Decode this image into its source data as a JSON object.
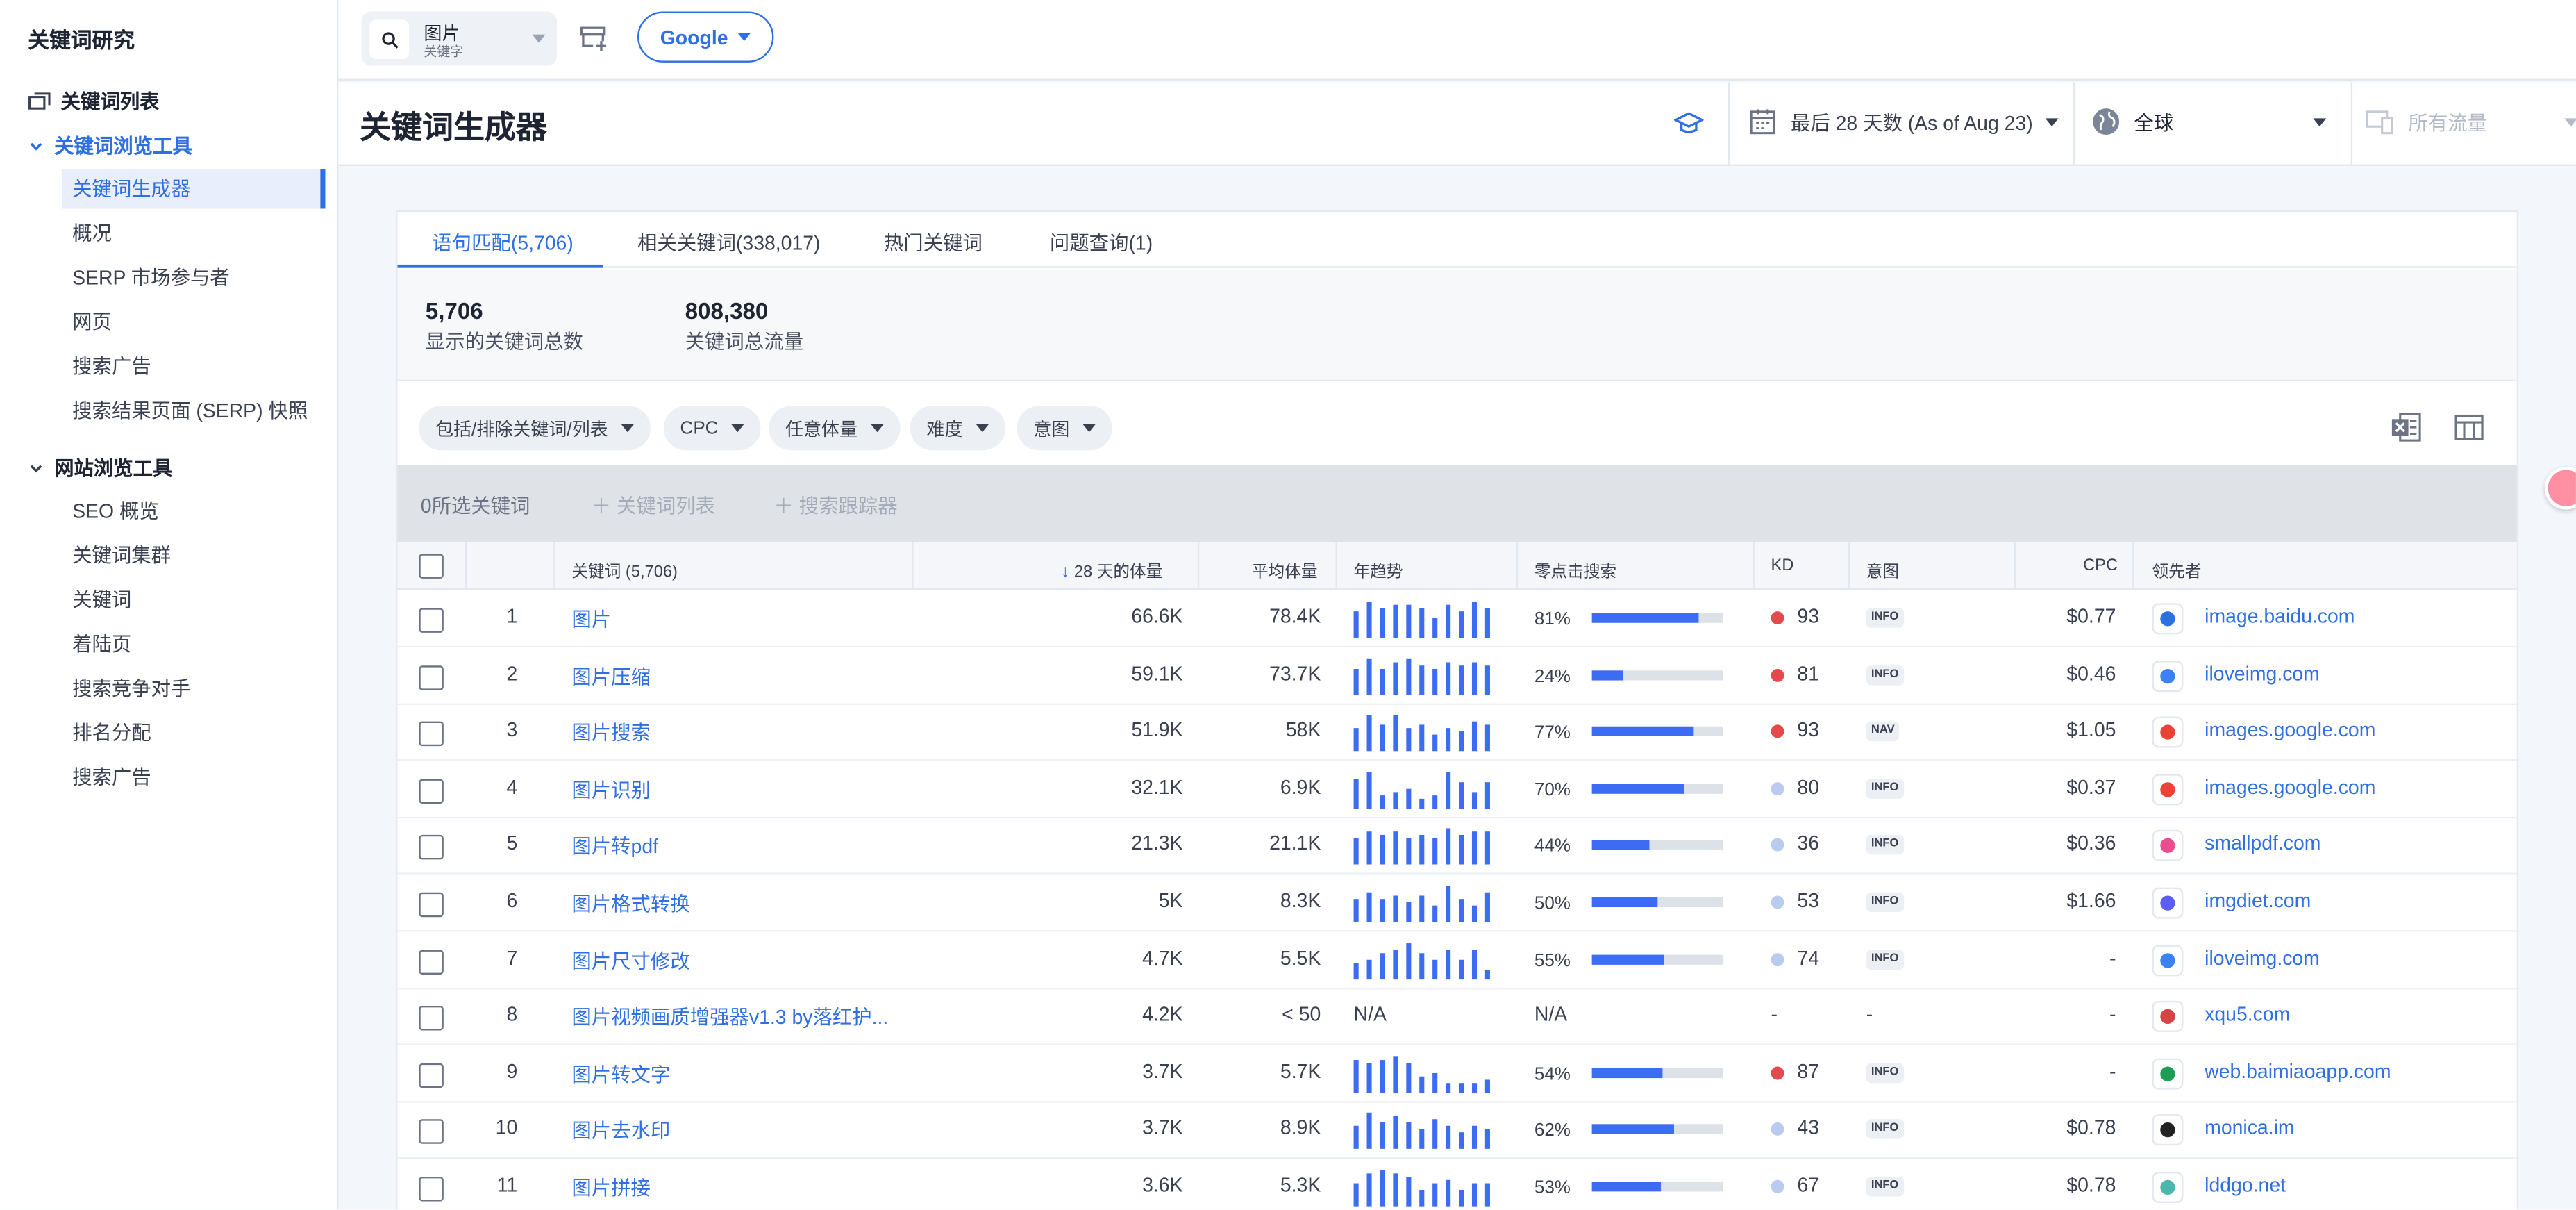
{
  "sidebar": {
    "title": "关键词研究",
    "list_label": "关键词列表",
    "section1_label": "关键词浏览工具",
    "section1_items": [
      {
        "label": "关键词生成器"
      },
      {
        "label": "概况"
      },
      {
        "label": "SERP 市场参与者"
      },
      {
        "label": "网页"
      },
      {
        "label": "搜索广告"
      },
      {
        "label": "搜索结果页面 (SERP) 快照"
      }
    ],
    "section2_label": "网站浏览工具",
    "section2_items": [
      {
        "label": "SEO 概览"
      },
      {
        "label": "关键词集群"
      },
      {
        "label": "关键词"
      },
      {
        "label": "着陆页"
      },
      {
        "label": "搜索竞争对手"
      },
      {
        "label": "排名分配"
      },
      {
        "label": "搜索广告"
      }
    ]
  },
  "topbar": {
    "search_value": "图片",
    "search_type": "关键字",
    "engine_label": "Google"
  },
  "header": {
    "title": "关键词生成器",
    "date_range": "最后 28 天数 (As of Aug 23)",
    "region": "全球",
    "traffic": "所有流量"
  },
  "tabs": [
    {
      "label": "语句匹配(5,706)"
    },
    {
      "label": "相关关键词(338,017)"
    },
    {
      "label": "热门关键词"
    },
    {
      "label": "问题查询(1)"
    }
  ],
  "stats": {
    "total_keywords": "5,706",
    "total_keywords_label": "显示的关键词总数",
    "total_traffic": "808,380",
    "total_traffic_label": "关键词总流量"
  },
  "filters": [
    {
      "label": "包括/排除关键词/列表"
    },
    {
      "label": "CPC"
    },
    {
      "label": "任意体量"
    },
    {
      "label": "难度"
    },
    {
      "label": "意图"
    }
  ],
  "selection": {
    "count_label": "0所选关键词",
    "add_list": "关键词列表",
    "add_tracker": "搜索跟踪器"
  },
  "table": {
    "headers": {
      "keyword": "关键词 (5,706)",
      "volume28": "28 天的体量",
      "avg": "平均体量",
      "trend": "年趋势",
      "zero_click": "零点击搜索",
      "kd": "KD",
      "intent": "意图",
      "cpc": "CPC",
      "leader": "领先者"
    },
    "rows": [
      {
        "rank": "1",
        "keyword": "图片",
        "volume": "66.6K",
        "avg": "78.4K",
        "trend": [
          16,
          22,
          18,
          20,
          20,
          18,
          12,
          20,
          16,
          22,
          18
        ],
        "zero": "81%",
        "zero_frac": 0.81,
        "kd": "93",
        "kd_color": "#e5484d",
        "intent": "INFO",
        "cpc": "$0.77",
        "leader": "image.baidu.com",
        "fav": "paw-icon",
        "fav_color": "#2f6fe4"
      },
      {
        "rank": "2",
        "keyword": "图片压缩",
        "volume": "59.1K",
        "avg": "73.7K",
        "trend": [
          16,
          22,
          16,
          20,
          22,
          18,
          16,
          20,
          18,
          20,
          18
        ],
        "zero": "24%",
        "zero_frac": 0.24,
        "kd": "81",
        "kd_color": "#e5484d",
        "intent": "INFO",
        "cpc": "$0.46",
        "leader": "iloveimg.com",
        "fav": "heart-icon",
        "fav_color": "#3b82f6"
      },
      {
        "rank": "3",
        "keyword": "图片搜索",
        "volume": "51.9K",
        "avg": "58K",
        "trend": [
          14,
          22,
          16,
          22,
          14,
          16,
          10,
          14,
          12,
          18,
          16
        ],
        "zero": "77%",
        "zero_frac": 0.77,
        "kd": "93",
        "kd_color": "#e5484d",
        "intent": "NAV",
        "cpc": "$1.05",
        "leader": "images.google.com",
        "fav": "google-icon",
        "fav_color": "#ea4335"
      },
      {
        "rank": "4",
        "keyword": "图片识别",
        "volume": "32.1K",
        "avg": "6.9K",
        "trend": [
          18,
          22,
          8,
          10,
          12,
          6,
          8,
          22,
          16,
          10,
          16
        ],
        "zero": "70%",
        "zero_frac": 0.7,
        "kd": "80",
        "kd_color": "#b9ccef",
        "intent": "INFO",
        "cpc": "$0.37",
        "leader": "images.google.com",
        "fav": "google-icon",
        "fav_color": "#ea4335"
      },
      {
        "rank": "5",
        "keyword": "图片转pdf",
        "volume": "21.3K",
        "avg": "21.1K",
        "trend": [
          16,
          20,
          18,
          20,
          16,
          18,
          16,
          22,
          18,
          20,
          20
        ],
        "zero": "44%",
        "zero_frac": 0.44,
        "kd": "36",
        "kd_color": "#b9ccef",
        "intent": "INFO",
        "cpc": "$0.36",
        "leader": "smallpdf.com",
        "fav": "smallpdf-icon",
        "fav_color": "#e94f8f"
      },
      {
        "rank": "6",
        "keyword": "图片格式转换",
        "volume": "5K",
        "avg": "8.3K",
        "trend": [
          14,
          18,
          14,
          16,
          12,
          16,
          10,
          22,
          14,
          10,
          18
        ],
        "zero": "50%",
        "zero_frac": 0.5,
        "kd": "53",
        "kd_color": "#b9ccef",
        "intent": "INFO",
        "cpc": "$1.66",
        "leader": "imgdiet.com",
        "fav": "imgdiet-icon",
        "fav_color": "#5b5ef0"
      },
      {
        "rank": "7",
        "keyword": "图片尺寸修改",
        "volume": "4.7K",
        "avg": "5.5K",
        "trend": [
          10,
          12,
          16,
          18,
          22,
          16,
          12,
          18,
          12,
          18,
          6
        ],
        "zero": "55%",
        "zero_frac": 0.55,
        "kd": "74",
        "kd_color": "#b9ccef",
        "intent": "INFO",
        "cpc": "-",
        "leader": "iloveimg.com",
        "fav": "heart-icon",
        "fav_color": "#3b82f6"
      },
      {
        "rank": "8",
        "keyword": "图片视频画质增强器v1.3 by落红护...",
        "volume": "4.2K",
        "avg": "< 50",
        "trend_text": "N/A",
        "zero": "N/A",
        "kd": "-",
        "intent_text": "-",
        "cpc": "-",
        "leader": "xqu5.com",
        "fav": "house-icon",
        "fav_color": "#d64545"
      },
      {
        "rank": "9",
        "keyword": "图片转文字",
        "volume": "3.7K",
        "avg": "5.7K",
        "trend": [
          20,
          18,
          20,
          22,
          18,
          10,
          12,
          6,
          6,
          6,
          8
        ],
        "zero": "54%",
        "zero_frac": 0.54,
        "kd": "87",
        "kd_color": "#e5484d",
        "intent": "INFO",
        "cpc": "-",
        "leader": "web.baimiaoapp.com",
        "fav": "leaf-icon",
        "fav_color": "#1f9d55"
      },
      {
        "rank": "10",
        "keyword": "图片去水印",
        "volume": "3.7K",
        "avg": "8.9K",
        "trend": [
          14,
          22,
          16,
          20,
          16,
          12,
          18,
          14,
          10,
          14,
          12
        ],
        "zero": "62%",
        "zero_frac": 0.62,
        "kd": "43",
        "kd_color": "#b9ccef",
        "intent": "INFO",
        "cpc": "$0.78",
        "leader": "monica.im",
        "fav": "monica-icon",
        "fav_color": "#222222"
      },
      {
        "rank": "11",
        "keyword": "图片拼接",
        "volume": "3.6K",
        "avg": "5.3K",
        "trend": [
          14,
          20,
          22,
          20,
          18,
          10,
          14,
          16,
          10,
          14,
          14
        ],
        "zero": "53%",
        "zero_frac": 0.53,
        "kd": "67",
        "kd_color": "#b9ccef",
        "intent": "INFO",
        "cpc": "$0.78",
        "leader": "lddgo.net",
        "fav": "snowflake-icon",
        "fav_color": "#4db6ac"
      }
    ]
  }
}
